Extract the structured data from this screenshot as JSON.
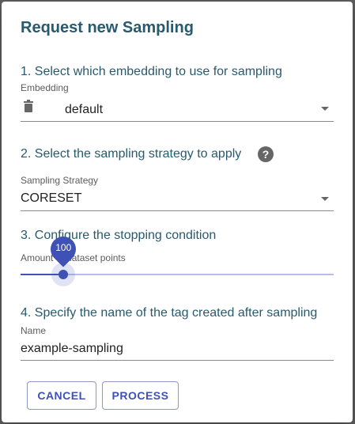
{
  "dialog": {
    "title": "Request new Sampling"
  },
  "embedding": {
    "step_label": "1. Select which embedding to use for sampling",
    "field_label": "Embedding",
    "value": "default",
    "leading_icon": "trash-icon"
  },
  "strategy": {
    "step_label": "2. Select the sampling strategy to apply",
    "field_label": "Sampling Strategy",
    "value": "CORESET",
    "help_icon": "help-circle-icon",
    "help_glyph": "?"
  },
  "stopping": {
    "step_label": "3. Configure the stopping condition",
    "field_label": "Amount of dataset points",
    "value": 100,
    "value_label": "100",
    "fill_fraction": 0.137
  },
  "tag": {
    "step_label": "4. Specify the name of the tag created after sampling",
    "field_label": "Name",
    "value": "example-sampling"
  },
  "actions": {
    "cancel_label": "CANCEL",
    "process_label": "PROCESS"
  },
  "colors": {
    "title": "#275a6e",
    "accent": "#3f51b5",
    "overlay": "#5f5f5f"
  }
}
